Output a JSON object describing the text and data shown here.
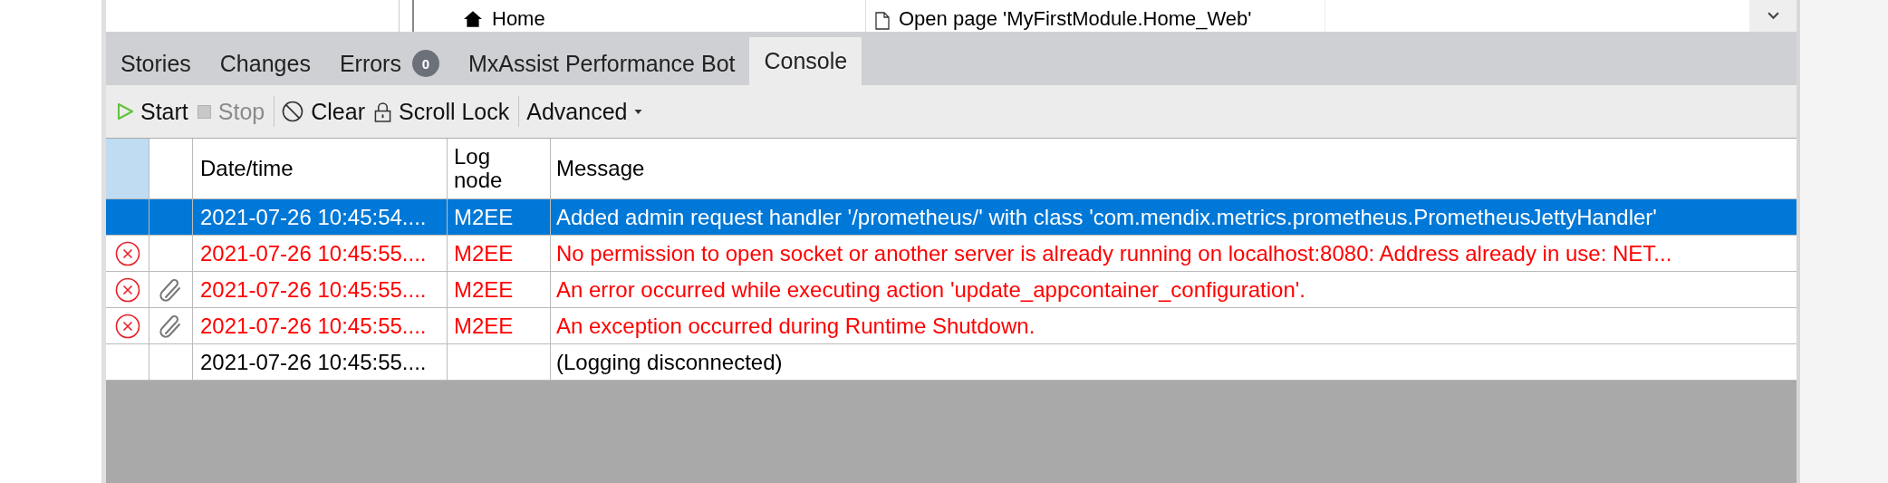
{
  "background_grid": {
    "row": {
      "name": "Home",
      "action": "Open page 'MyFirstModule.Home_Web'"
    }
  },
  "tabs": [
    {
      "label": "Stories",
      "selected": false
    },
    {
      "label": "Changes",
      "selected": false
    },
    {
      "label": "Errors",
      "selected": false,
      "badge": "0"
    },
    {
      "label": "MxAssist Performance Bot",
      "selected": false
    },
    {
      "label": "Console",
      "selected": true
    }
  ],
  "toolbar": [
    {
      "kind": "start",
      "label": "Start",
      "disabled": false
    },
    {
      "kind": "stop",
      "label": "Stop",
      "disabled": true
    },
    {
      "kind": "clear",
      "label": "Clear",
      "disabled": false
    },
    {
      "kind": "lock",
      "label": "Scroll Lock",
      "disabled": false
    },
    {
      "kind": "dropdown",
      "label": "Advanced",
      "disabled": false
    }
  ],
  "table": {
    "columns": [
      "Date/time",
      "Log node",
      "Message"
    ],
    "rows": [
      {
        "selected": true,
        "error": false,
        "attachment": false,
        "datetime": "2021-07-26 10:45:54....",
        "node": "M2EE",
        "message": "Added admin request handler '/prometheus/' with class 'com.mendix.metrics.prometheus.PrometheusJettyHandler'"
      },
      {
        "selected": false,
        "error": true,
        "attachment": false,
        "datetime": "2021-07-26 10:45:55....",
        "node": "M2EE",
        "message": "No permission to open socket or another server is already running on localhost:8080: Address already in use: NET..."
      },
      {
        "selected": false,
        "error": true,
        "attachment": true,
        "datetime": "2021-07-26 10:45:55....",
        "node": "M2EE",
        "message": "An error occurred while executing action 'update_appcontainer_configuration'."
      },
      {
        "selected": false,
        "error": true,
        "attachment": true,
        "datetime": "2021-07-26 10:45:55....",
        "node": "M2EE",
        "message": "An exception occurred during Runtime Shutdown."
      },
      {
        "selected": false,
        "error": false,
        "attachment": false,
        "datetime": "2021-07-26 10:45:55....",
        "message": "(Logging disconnected)"
      }
    ]
  }
}
